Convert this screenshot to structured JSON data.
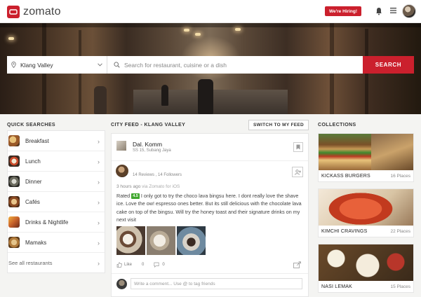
{
  "header": {
    "brand": "zomato",
    "hiring_label": "We're Hiring!",
    "icons": [
      "bell-icon",
      "menu-icon",
      "user-avatar"
    ]
  },
  "search": {
    "location_value": "Klang Valley",
    "placeholder": "Search for restaurant, cuisine or a dish",
    "button_label": "SEARCH"
  },
  "quick_searches": {
    "title": "QUICK SEARCHES",
    "items": [
      {
        "label": "Breakfast"
      },
      {
        "label": "Lunch"
      },
      {
        "label": "Dinner"
      },
      {
        "label": "Cafés"
      },
      {
        "label": "Drinks & Nightlife"
      },
      {
        "label": "Mamaks"
      }
    ],
    "see_all": "See all restaurants"
  },
  "feed": {
    "title": "CITY FEED - KLANG VALLEY",
    "switch_label": "SWITCH TO MY FEED",
    "post": {
      "restaurant": "Dal. Komm",
      "location": "SS 15, Subang Jaya",
      "user_stats": "14 Reviews , 14 Followers",
      "time": "3 hours ago",
      "time_via": "via Zomato for iOS",
      "rated_label": "Rated",
      "rating": "4.5",
      "review": "I only got to try the choco lava bingsu here. I dont really love the shave ice. Love the ow! espresso ones better. But its still delicious with the chocolate lava cake on top of the bingsu. Will try the honey toast and their signature drinks on my next visit",
      "like_label": "Like",
      "like_count": "0",
      "comment_count": "0"
    },
    "comment_placeholder": "Write a comment... Use @ to tag friends"
  },
  "collections": {
    "title": "COLLECTIONS",
    "items": [
      {
        "name": "KICKASS BURGERS",
        "count": "16 Places"
      },
      {
        "name": "KIMCHI CRAVINGS",
        "count": "22 Places"
      },
      {
        "name": "NASI LEMAK",
        "count": "15 Places"
      }
    ]
  },
  "colors": {
    "brand_red": "#cb202d",
    "rating_green": "#3fa72d",
    "page_bg": "#f4f4f2"
  }
}
